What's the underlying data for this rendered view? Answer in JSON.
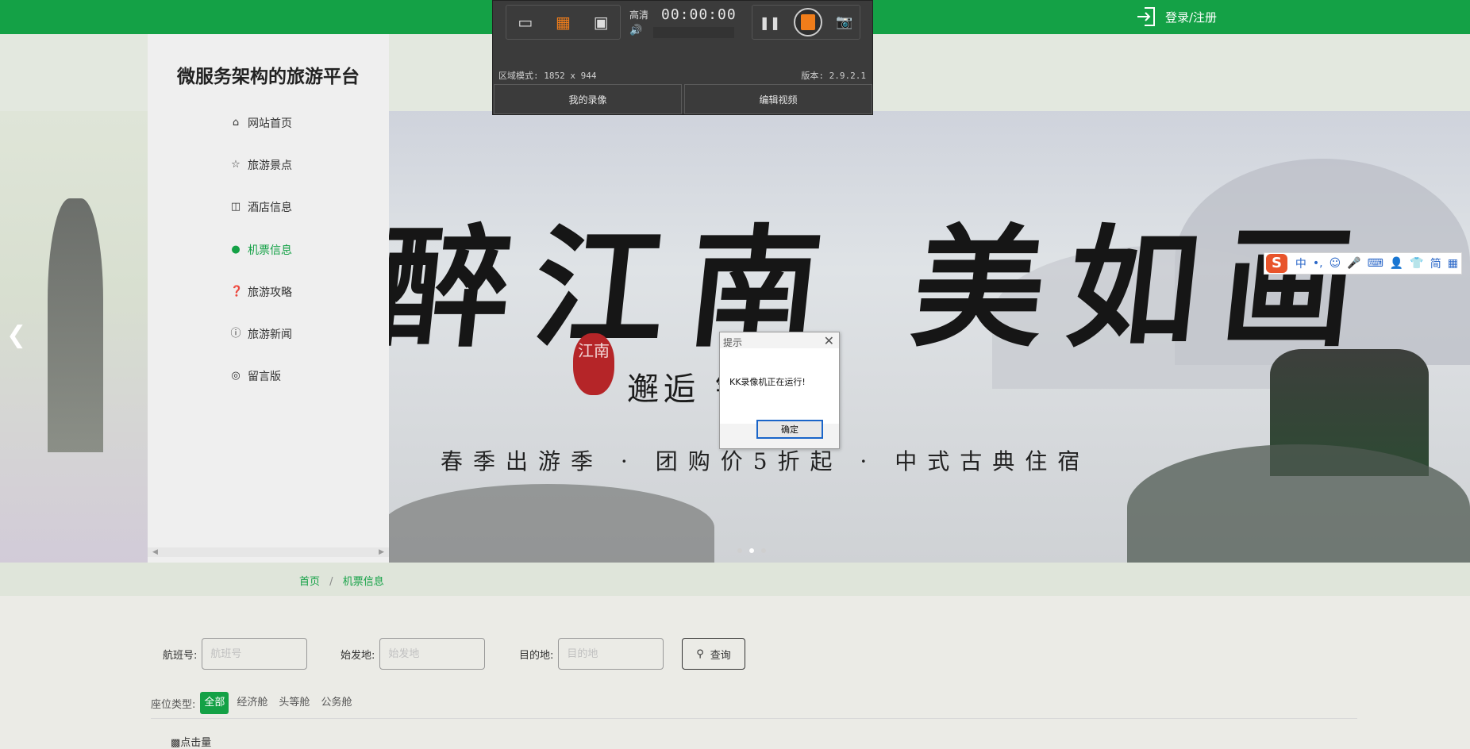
{
  "header": {
    "login_label": "登录/注册",
    "brand_color": "#14a146"
  },
  "sidebar": {
    "title": "微服务架构的旅游平台",
    "items": [
      {
        "label": "网站首页",
        "icon": "home-icon",
        "active": false
      },
      {
        "label": "旅游景点",
        "icon": "star-icon",
        "active": false
      },
      {
        "label": "酒店信息",
        "icon": "bag-icon",
        "active": false
      },
      {
        "label": "机票信息",
        "icon": "circle-dot-icon",
        "active": true
      },
      {
        "label": "旅游攻略",
        "icon": "question-circle-icon",
        "active": false
      },
      {
        "label": "旅游新闻",
        "icon": "info-circle-icon",
        "active": false
      },
      {
        "label": "留言版",
        "icon": "message-icon",
        "active": false
      }
    ]
  },
  "banner": {
    "calligraphy": "醉江南 美如画",
    "seal": "江南",
    "subtitle": "邂逅 镇",
    "slogan": "春季出游季 · 团购价5折起 · 中式古典住宿",
    "slides": 3,
    "active_slide": 2
  },
  "breadcrumb": {
    "home": "首页",
    "sep": "/",
    "current": "机票信息"
  },
  "search": {
    "flight_label": "航班号:",
    "flight_placeholder": "航班号",
    "from_label": "始发地:",
    "from_placeholder": "始发地",
    "to_label": "目的地:",
    "to_placeholder": "目的地",
    "query_label": "查询"
  },
  "seat": {
    "label": "座位类型:",
    "options": [
      "全部",
      "经济舱",
      "头等舱",
      "公务舱"
    ],
    "selected": "全部"
  },
  "sort": {
    "clicks_label": "点击量"
  },
  "recorder": {
    "quality": "高清",
    "timer": "00:00:00",
    "region": "区域模式: 1852 x 944",
    "version": "版本: 2.9.2.1",
    "my_recordings": "我的录像",
    "edit_video": "编辑视频",
    "accent": "#f07d1a"
  },
  "ime": {
    "logo": "S",
    "items": [
      "中",
      "•,",
      "☺",
      "🎤",
      "⌨",
      "👤",
      "👕",
      "简",
      "▦"
    ]
  },
  "dialog": {
    "title": "提示",
    "message": "KK录像机正在运行!",
    "ok_label": "确定"
  }
}
